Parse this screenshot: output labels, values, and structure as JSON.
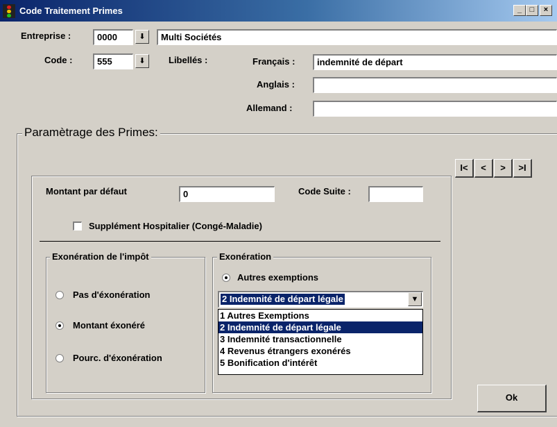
{
  "window": {
    "title": "Code Traitement Primes",
    "minimize": "_",
    "maximize": "□",
    "close": "×"
  },
  "header": {
    "entreprise_label": "Entreprise :",
    "entreprise_code": "0000",
    "entreprise_name": "Multi Sociétés",
    "code_label": "Code :",
    "code_value": "555",
    "libelles_label": "Libellés :",
    "francais_label": "Français :",
    "francais_value": "indemnité de départ",
    "anglais_label": "Anglais :",
    "anglais_value": "",
    "allemand_label": "Allemand :",
    "allemand_value": ""
  },
  "params": {
    "group_title": "Paramètrage des Primes:",
    "nav": {
      "first": "I<",
      "prev": "<",
      "next": ">",
      "last": ">I"
    },
    "montant_label": "Montant par défaut",
    "montant_value": "0",
    "code_suite_label": "Code Suite :",
    "code_suite_value": "",
    "supplement_label": "Supplément Hospitalier (Congé-Maladie)",
    "supplement_checked": false
  },
  "exoneration_impot": {
    "title": "Exonération de l'impôt",
    "options": [
      "Pas d'éxonération",
      "Montant éxonéré",
      "Pourc. d'éxonération"
    ],
    "selected_index": 1
  },
  "exoneration": {
    "title": "Exonération",
    "radio_label": "Autres exemptions",
    "radio_checked": true,
    "combo_value": "2 Indemnité de départ légale",
    "options": [
      "1 Autres Exemptions",
      "2 Indemnité de départ légale",
      "3 Indemnité transactionnelle",
      "4 Revenus étrangers exonérés",
      "5 Bonification d'intérêt"
    ],
    "selected_index": 1
  },
  "ok_label": "Ok"
}
